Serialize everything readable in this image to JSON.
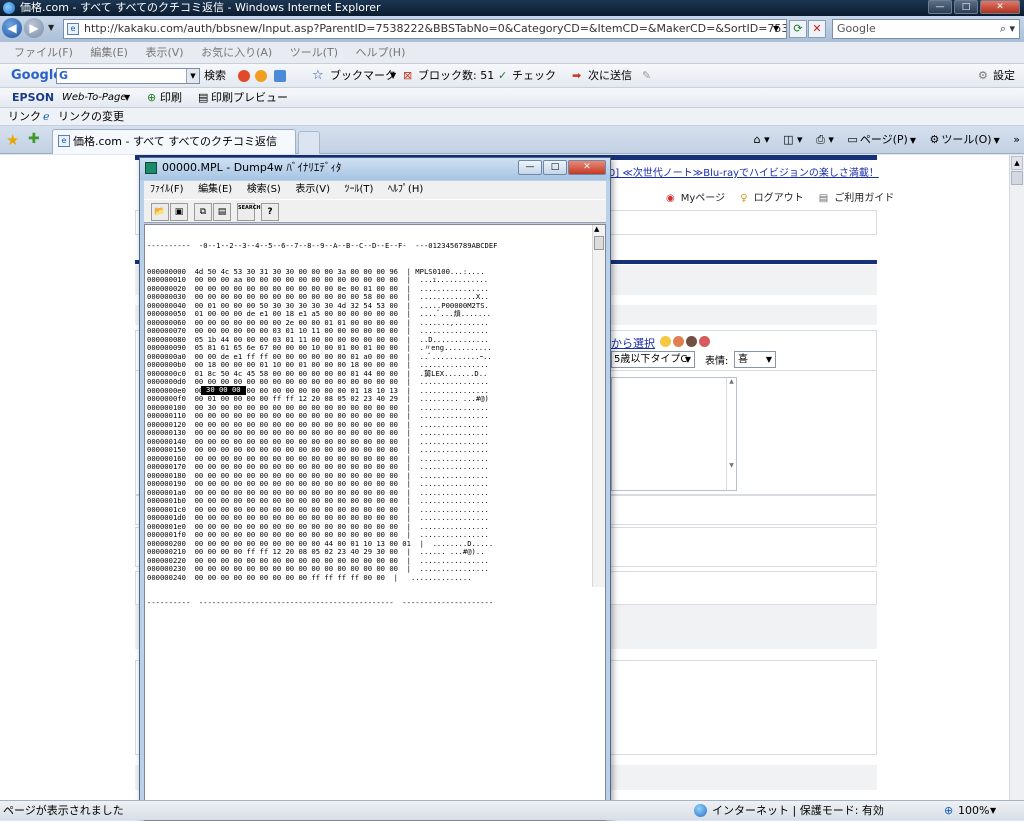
{
  "ie": {
    "title": "価格.com - すべて すべてのクチコミ返信 - Windows Internet Explorer",
    "url": "http://kakaku.com/auth/bbsnew/Input.asp?ParentID=7538222&BBSTabNo=0&CategoryCD=&ItemCD=&MakerCD=&SortID=7538222&ProductID",
    "search_placeholder": "Google",
    "menu": [
      "ファイル(F)",
      "編集(E)",
      "表示(V)",
      "お気に入り(A)",
      "ツール(T)",
      "ヘルプ(H)"
    ],
    "google_toolbar": {
      "logo": "Google",
      "search_label": "検索",
      "bookmarks": "ブックマーク",
      "block_count": "ブロック数: 51",
      "check": "チェック",
      "send_to": "次に送信",
      "settings": "設定"
    },
    "epson_toolbar": {
      "brand": "EPSON",
      "web_to_page": "Web-To-Page",
      "print": "印刷",
      "print_preview": "印刷プレビュー"
    },
    "links_toolbar": {
      "label": "リンク",
      "change_link": "リンクの変更"
    },
    "tab_title": "価格.com - すべて すべてのクチコミ返信",
    "command_bar": {
      "page": "ページ(P)",
      "tools": "ツール(O)"
    },
    "status": {
      "text": "ページが表示されました",
      "zone": "インターネット | 保護モード: 有効",
      "zoom": "100%"
    }
  },
  "page": {
    "promo_link": "[0] ≪次世代ノート≫Blu-rayでハイビジョンの楽しさ満載！",
    "mypage": "Myページ",
    "logout": "ログアウト",
    "guide": "ご利用ガイド",
    "choose_link": "から選択",
    "type_select": "5歳以下タイプC",
    "expression_label": "表情:",
    "expression_value": "喜"
  },
  "dump": {
    "title": "00000.MPL - Dump4w ﾊﾞｲﾅﾘｴﾃﾞｨﾀ",
    "menu": [
      "ﾌｧｲﾙ(F)",
      "編集(E)",
      "検索(S)",
      "表示(V)",
      "ﾂｰﾙ(T)",
      "ﾍﾙﾌﾟ(H)"
    ],
    "toolbar_search": "SEARCH",
    "header": "----------  -0--1--2--3--4--5--6--7--8--9--A--B--C--D--E--F-  ---0123456789ABCDEF",
    "rows": [
      "000000000  4d 50 4c 53 30 31 30 30 00 00 00 3a 00 00 00 96  | MPLS0100...:....",
      "000000010  00 00 00 aa 00 00 00 00 00 00 00 00 00 00 00 00  |  ...ｪ............",
      "000000020  00 00 00 00 00 00 00 00 00 00 00 0e 00 01 00 00  |  ................",
      "000000030  00 00 00 00 00 00 00 00 00 00 00 00 00 58 00 00  |  .............X..",
      "000000040  00 01 00 00 00 50 30 30 30 30 30 4d 32 54 53 00  |  .....P00000M2TS.",
      "000000050  01 00 00 00 de e1 00 18 e1 a5 00 00 00 00 00 00  |  ....ﾞ...熕.......",
      "000000060  00 00 00 00 00 00 00 2e 00 00 01 01 00 00 00 00  |  .......,........",
      "000000070  00 00 00 00 00 00 03 01 10 11 00 00 00 00 00 00  |  ................",
      "000000080  05 1b 44 00 00 00 03 01 11 00 00 00 00 00 00 00  |  ..D.............",
      "000000090  05 81 61 65 6e 67 00 00 00 10 00 01 00 01 00 00  |  .〃eng...........",
      "0000000a0  00 00 de e1 ff ff 00 00 00 00 00 00 01 a0 00 00  |  ..ﾞ...........ｰ..",
      "0000000b0  00 18 00 00 00 01 10 00 01 00 00 00 18 00 00 00  |  ................",
      "0000000c0  01 8c 50 4c 45 58 00 00 00 00 00 00 01 44 00 00  |  .舅LEX.......D..",
      "0000000d0  00 00 00 00 00 00 00 00 00 00 00 00 00 00 00 00  |  ................",
      "0000000e0  00 00 00 00 00 00 00 00 00 00 00 00 01 18 10 13  |  ................",
      "0000000f0  00 01 00 00 00 00 ff ff 12 20 08 05 02 23 40 29  |  ......... ...#@)",
      "000000100  00 30 00 00 00 00 00 00 00 00 00 00 00 00 00 00  |  ................",
      "000000110  00 00 00 00 00 00 00 00 00 00 00 00 00 00 00 00  |  ................",
      "000000120  00 00 00 00 00 00 00 00 00 00 00 00 00 00 00 00  |  ................",
      "000000130  00 00 00 00 00 00 00 00 00 00 00 00 00 00 00 00  |  ................",
      "000000140  00 00 00 00 00 00 00 00 00 00 00 00 00 00 00 00  |  ................",
      "000000150  00 00 00 00 00 00 00 00 00 00 00 00 00 00 00 00  |  ................",
      "000000160  00 00 00 00 00 00 00 00 00 00 00 00 00 00 00 00  |  ................",
      "000000170  00 00 00 00 00 00 00 00 00 00 00 00 00 00 00 00  |  ................",
      "000000180  00 00 00 00 00 00 00 00 00 00 00 00 00 00 00 00  |  ................",
      "000000190  00 00 00 00 00 00 00 00 00 00 00 00 00 00 00 00  |  ................",
      "0000001a0  00 00 00 00 00 00 00 00 00 00 00 00 00 00 00 00  |  ................",
      "0000001b0  00 00 00 00 00 00 00 00 00 00 00 00 00 00 00 00  |  ................",
      "0000001c0  00 00 00 00 00 00 00 00 00 00 00 00 00 00 00 00  |  ................",
      "0000001d0  00 00 00 00 00 00 00 00 00 00 00 00 00 00 00 00  |  ................",
      "0000001e0  00 00 00 00 00 00 00 00 00 00 00 00 00 00 00 00  |  ................",
      "0000001f0  00 00 00 00 00 00 00 00 00 00 00 00 00 00 00 00  |  ................",
      "000000200  00 00 00 00 00 00 00 00 00 00 44 00 01 10 13 00 01  |  ........D.....",
      "000000210  00 00 00 00 ff ff 12 20 08 05 02 23 40 29 30 00  |  ...... ...#@)..",
      "000000220  00 00 00 00 00 00 00 00 00 00 00 00 00 00 00 00  |  ................",
      "000000230  00 00 00 00 00 00 00 00 00 00 00 00 00 00 00 00  |  ................",
      "000000240  00 00 00 00 00 00 00 00 00 ff ff ff ff 00 00  |   .............."
    ],
    "footer": "----------  ---------------------------------------------  ---------------------",
    "selected_bytes": "30 00 00"
  },
  "colors": {
    "page_blue_bar": "#15317a",
    "link": "#1a2ea8",
    "selection": "#000000"
  }
}
